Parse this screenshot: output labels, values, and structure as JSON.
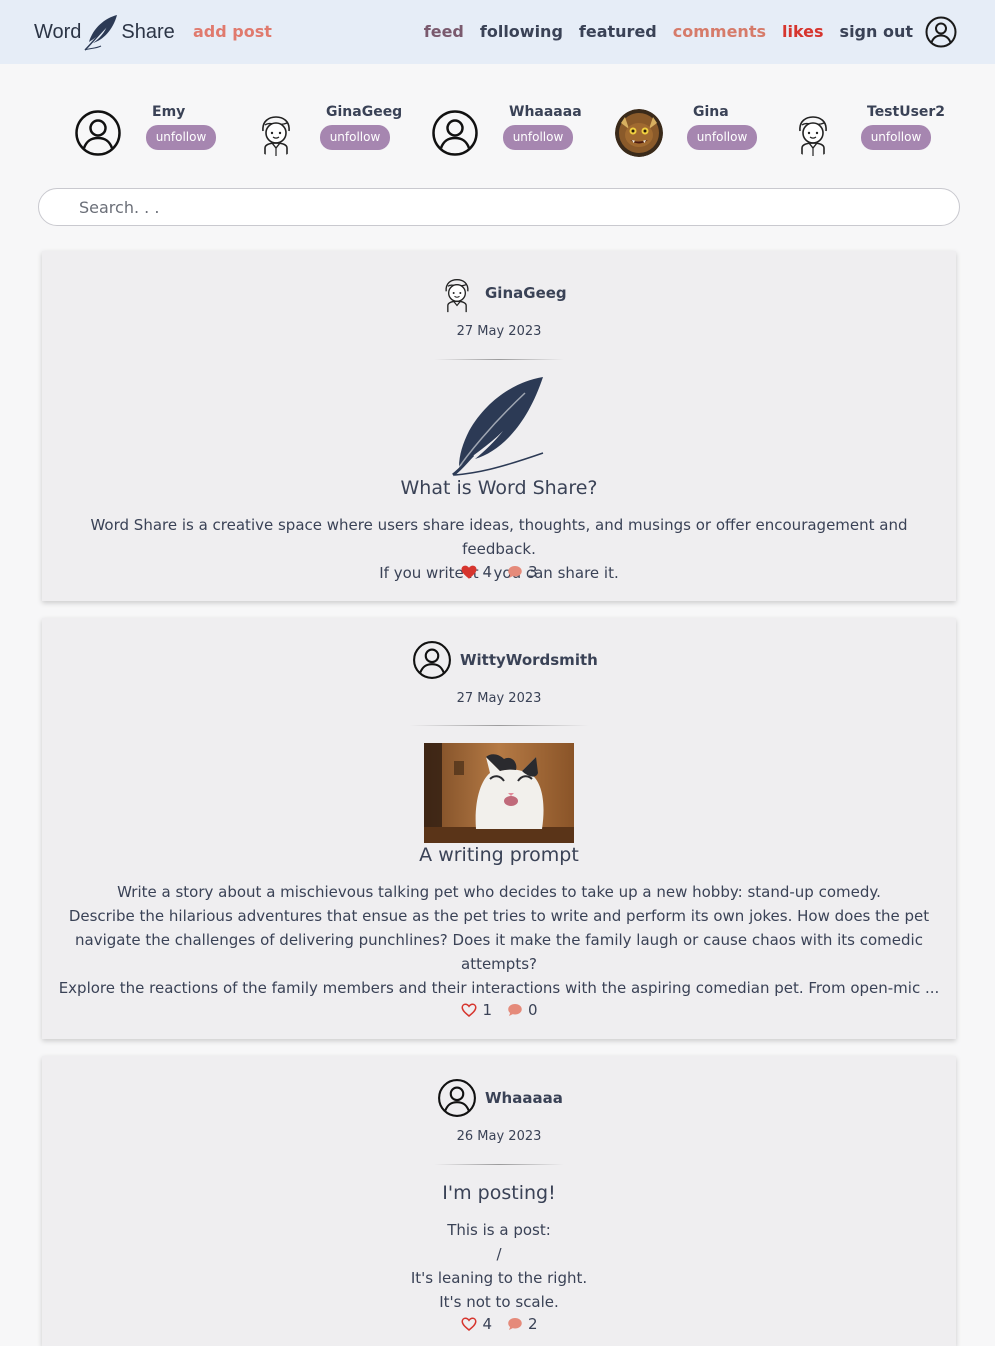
{
  "header": {
    "brand_left": "Word",
    "brand_right": "Share",
    "add_post": "add post",
    "nav": {
      "feed": "feed",
      "following": "following",
      "featured": "featured",
      "comments": "comments",
      "likes": "likes",
      "sign_out": "sign out"
    },
    "account_icon": "user-circle-icon"
  },
  "following": [
    {
      "name": "Emy",
      "action": "unfollow",
      "avatar": "user-circle-icon"
    },
    {
      "name": "GinaGeeg",
      "action": "unfollow",
      "avatar": "boy-avatar-icon"
    },
    {
      "name": "Whaaaaa",
      "action": "unfollow",
      "avatar": "user-circle-icon"
    },
    {
      "name": "Gina",
      "action": "unfollow",
      "avatar": "monster-avatar-photo"
    },
    {
      "name": "TestUser2",
      "action": "unfollow",
      "avatar": "boy-avatar-icon"
    }
  ],
  "search": {
    "placeholder": "Search. . ."
  },
  "posts": [
    {
      "author": "GinaGeeg",
      "date": "27 May 2023",
      "title": "What is Word Share?",
      "image": "quill-feather-icon",
      "body": [
        "Word Share is a creative space where users share ideas, thoughts, and musings or offer encouragement and feedback.",
        "If you write it - you can share it."
      ],
      "likes": "4",
      "comments": "3",
      "liked": true
    },
    {
      "author": "WittyWordsmith",
      "date": "27 May 2023",
      "title": "A writing prompt",
      "image": "cat-photo",
      "body": [
        "Write a story about a mischievous talking pet who decides to take up a new hobby: stand-up comedy.",
        "Describe the hilarious adventures that ensue as the pet tries to write and perform its own jokes. How does the pet navigate the challenges of delivering punchlines? Does it make the family laugh or cause chaos with its comedic attempts?",
        "Explore the reactions of the family members and their interactions with the aspiring comedian pet. From open-mic ..."
      ],
      "likes": "1",
      "comments": "0",
      "liked": false
    },
    {
      "author": "Whaaaaa",
      "date": "26 May 2023",
      "title": "I'm posting!",
      "body": [
        "This is a post:",
        "/",
        "It's leaning to the right.",
        "It's not to scale."
      ],
      "likes": "4",
      "comments": "2",
      "liked": false
    }
  ],
  "colors": {
    "header_bg": "#e6edf7",
    "accent_pink": "#e07a6e",
    "likes_red": "#d6352e",
    "unfollow_purple": "#a686b0",
    "text_navy": "#3a4256",
    "comment_bubble": "#e58a7a"
  }
}
